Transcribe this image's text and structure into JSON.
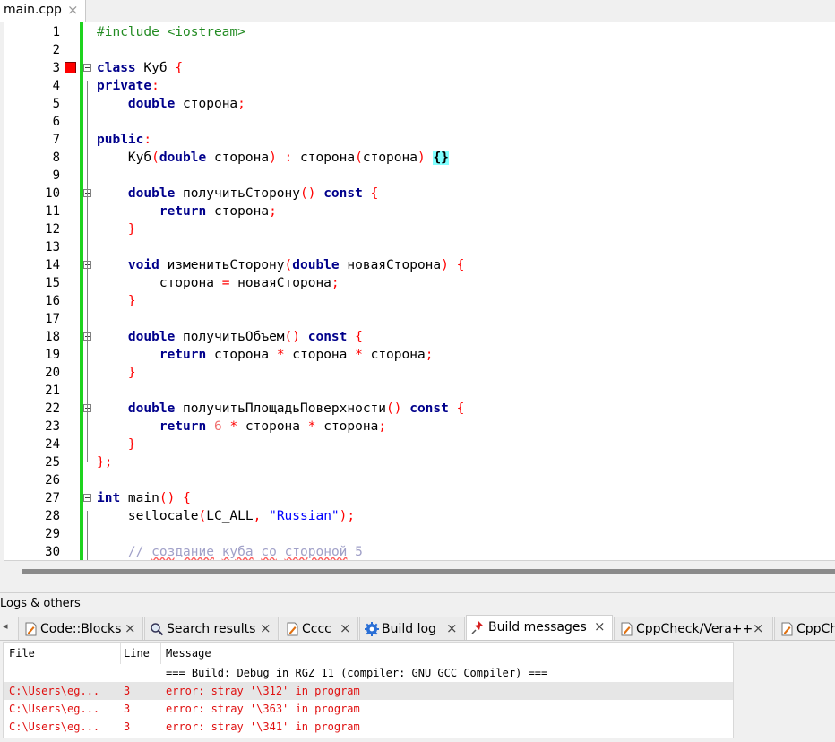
{
  "editor_tab": {
    "label": "main.cpp",
    "close": "×"
  },
  "code_lines": [
    {
      "n": "1",
      "html": "<span class=\"pp\">#include &lt;iostream&gt;</span>"
    },
    {
      "n": "2",
      "html": ""
    },
    {
      "n": "3",
      "html": "<span class=\"kw\">class</span> Куб <span class=\"op\">{</span>"
    },
    {
      "n": "4",
      "html": "<span class=\"kw\">private</span><span class=\"op\">:</span>"
    },
    {
      "n": "5",
      "html": "    <span class=\"kw\">double</span> сторона<span class=\"op\">;</span>"
    },
    {
      "n": "6",
      "html": ""
    },
    {
      "n": "7",
      "html": "<span class=\"kw\">public</span><span class=\"op\">:</span>"
    },
    {
      "n": "8",
      "html": "    Куб<span class=\"op\">(</span><span class=\"kw\">double</span> сторона<span class=\"op\">)</span> <span class=\"op\">:</span> сторона<span class=\"op\">(</span>сторона<span class=\"op\">)</span> <span class=\"hl\">{}</span>"
    },
    {
      "n": "9",
      "html": ""
    },
    {
      "n": "10",
      "html": "    <span class=\"kw\">double</span> получитьСторону<span class=\"op\">()</span> <span class=\"kw\">const</span> <span class=\"op\">{</span>"
    },
    {
      "n": "11",
      "html": "        <span class=\"kw\">return</span> сторона<span class=\"op\">;</span>"
    },
    {
      "n": "12",
      "html": "    <span class=\"op\">}</span>"
    },
    {
      "n": "13",
      "html": ""
    },
    {
      "n": "14",
      "html": "    <span class=\"kw\">void</span> изменитьСторону<span class=\"op\">(</span><span class=\"kw\">double</span> новаяСторона<span class=\"op\">)</span> <span class=\"op\">{</span>"
    },
    {
      "n": "15",
      "html": "        сторона <span class=\"op\">=</span> новаяСторона<span class=\"op\">;</span>"
    },
    {
      "n": "16",
      "html": "    <span class=\"op\">}</span>"
    },
    {
      "n": "17",
      "html": ""
    },
    {
      "n": "18",
      "html": "    <span class=\"kw\">double</span> получитьОбъем<span class=\"op\">()</span> <span class=\"kw\">const</span> <span class=\"op\">{</span>"
    },
    {
      "n": "19",
      "html": "        <span class=\"kw\">return</span> сторона <span class=\"op\">*</span> сторона <span class=\"op\">*</span> сторона<span class=\"op\">;</span>"
    },
    {
      "n": "20",
      "html": "    <span class=\"op\">}</span>"
    },
    {
      "n": "21",
      "html": ""
    },
    {
      "n": "22",
      "html": "    <span class=\"kw\">double</span> получитьПлощадьПоверхности<span class=\"op\">()</span> <span class=\"kw\">const</span> <span class=\"op\">{</span>"
    },
    {
      "n": "23",
      "html": "        <span class=\"kw\">return</span> <span class=\"num\">6</span> <span class=\"op\">*</span> сторона <span class=\"op\">*</span> сторона<span class=\"op\">;</span>"
    },
    {
      "n": "24",
      "html": "    <span class=\"op\">}</span>"
    },
    {
      "n": "25",
      "html": "<span class=\"op\">};</span>"
    },
    {
      "n": "26",
      "html": ""
    },
    {
      "n": "27",
      "html": "<span class=\"kw\">int</span> main<span class=\"op\">()</span> <span class=\"op\">{</span>"
    },
    {
      "n": "28",
      "html": "    setlocale<span class=\"op\">(</span>LC_ALL<span class=\"op\">,</span> <span class=\"str\">\"Russian\"</span><span class=\"op\">);</span>"
    },
    {
      "n": "29",
      "html": ""
    },
    {
      "n": "30",
      "html": "    <span class=\"cmt\">// </span><span class=\"cmt-u\">создание</span><span class=\"cmt\"> </span><span class=\"cmt-u\">куба</span><span class=\"cmt\"> </span><span class=\"cmt-u\">со</span><span class=\"cmt\"> </span><span class=\"cmt-u\">стороной</span><span class=\"cmt\"> 5</span>"
    }
  ],
  "logs": {
    "title": "Logs & others",
    "tabs": [
      {
        "label": "Code::Blocks",
        "icon": "page-icon"
      },
      {
        "label": "Search results",
        "icon": "magnifier-icon"
      },
      {
        "label": "Cccc",
        "icon": "page-icon"
      },
      {
        "label": "Build log",
        "icon": "gear-icon"
      },
      {
        "label": "Build messages",
        "icon": "pin-icon"
      },
      {
        "label": "CppCheck/Vera++",
        "icon": "page-icon"
      },
      {
        "label": "CppCh",
        "icon": "page-icon"
      }
    ],
    "columns": {
      "file": "File",
      "line": "Line",
      "message": "Message"
    },
    "rows": [
      {
        "file": "",
        "line": "",
        "message": "=== Build: Debug in RGZ 11 (compiler: GNU GCC Compiler) ==="
      },
      {
        "file": "C:\\Users\\eg...",
        "line": "3",
        "message": "error: stray '\\312' in program"
      },
      {
        "file": "C:\\Users\\eg...",
        "line": "3",
        "message": "error: stray '\\363' in program"
      },
      {
        "file": "C:\\Users\\eg...",
        "line": "3",
        "message": "error: stray '\\341' in program"
      }
    ]
  },
  "colors": {
    "keyword": "#00008b",
    "operator": "#ff0000",
    "change_bar": "#1ed31e",
    "error": "#e01010",
    "brace_match": "#80ffff"
  }
}
